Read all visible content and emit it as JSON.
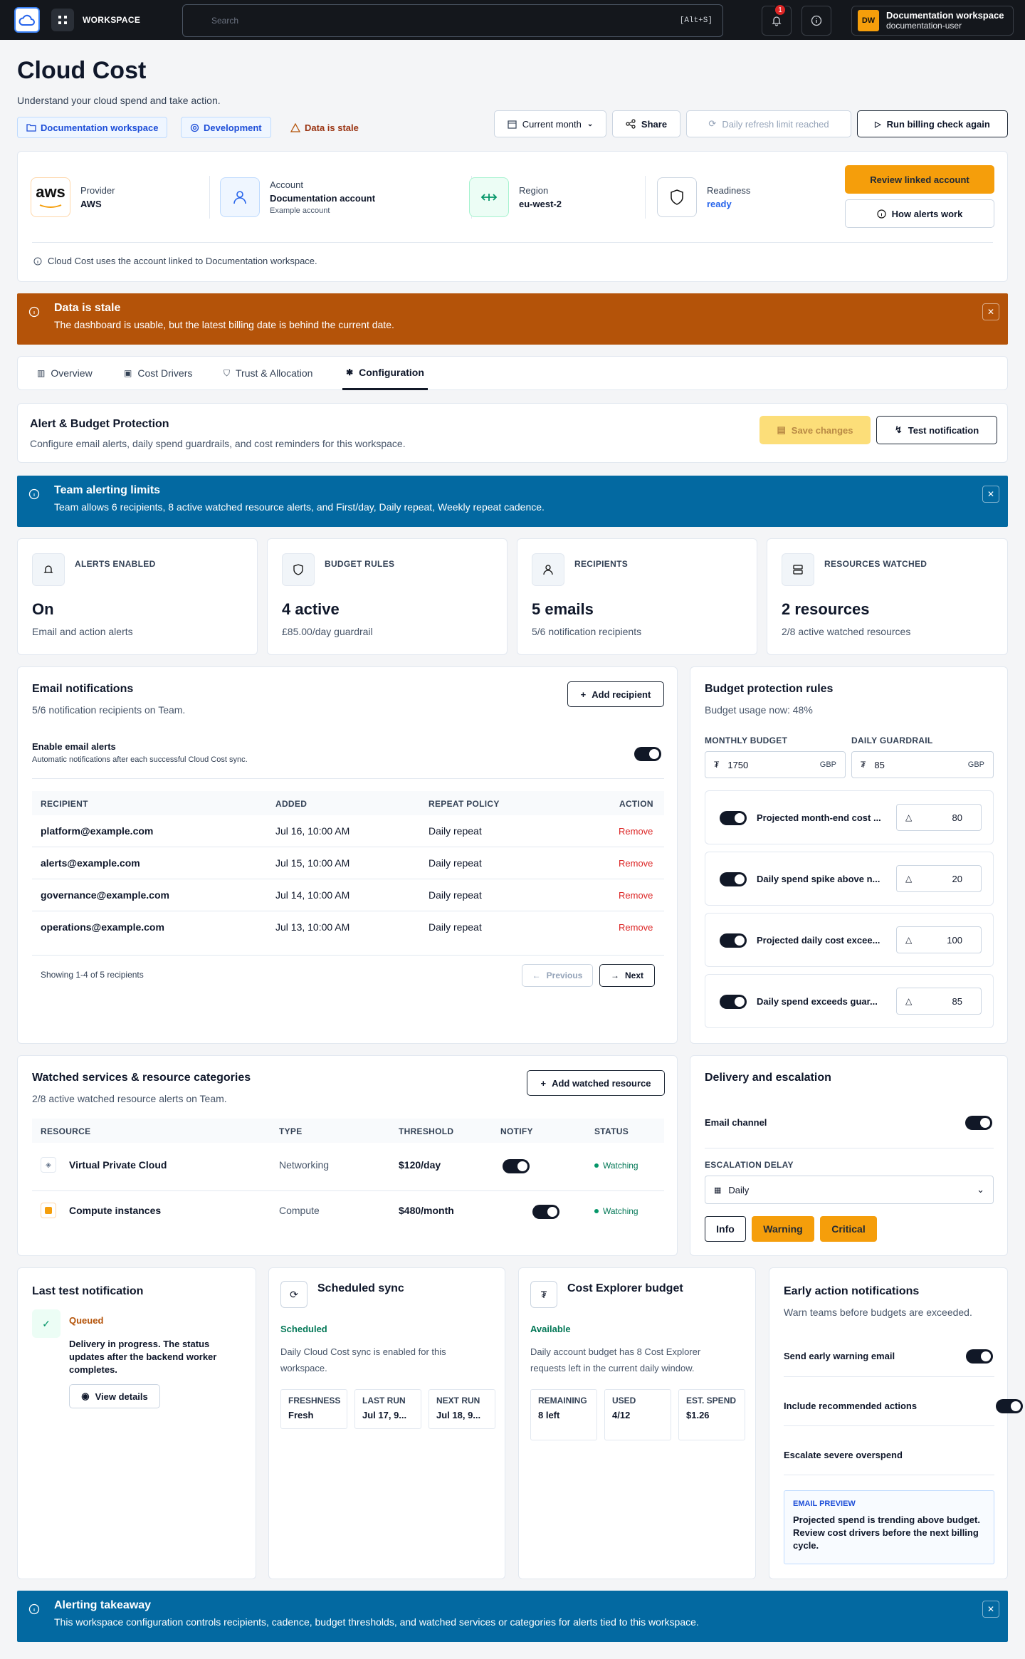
{
  "topbar": {
    "workspace_label": "WORKSPACE",
    "search_placeholder": "Search",
    "search_shortcut": "[Alt+S]",
    "notif_count": "1",
    "avatar_initials": "DW",
    "user_org": "Documentation workspace",
    "user_name": "documentation-user"
  },
  "header": {
    "title": "Cloud Cost",
    "subtitle": "Understand your cloud spend and take action.",
    "pill_workspace": "Documentation workspace",
    "pill_env": "Development",
    "stale_label": "Data is stale",
    "period": "Current month",
    "share": "Share",
    "refresh_limit": "Daily refresh limit reached",
    "run_billing": "Run billing check again"
  },
  "account": {
    "provider_label": "Provider",
    "provider_value": "AWS",
    "provider_logo": "aws",
    "account_label": "Account",
    "account_value": "Documentation account",
    "account_sub": "Example account",
    "region_label": "Region",
    "region_value": "eu-west-2",
    "readiness_label": "Readiness",
    "readiness_value": "ready",
    "review_button": "Review linked account",
    "alerts_button": "How alerts work",
    "note": "Cloud Cost uses the account linked to Documentation workspace."
  },
  "stale_banner": {
    "title": "Data is stale",
    "body": "The dashboard is usable, but the latest billing date is behind the current date."
  },
  "tabs": [
    "Overview",
    "Cost Drivers",
    "Trust & Allocation",
    "Configuration"
  ],
  "alert_section": {
    "title": "Alert & Budget Protection",
    "subtitle": "Configure email alerts, daily spend guardrails, and cost reminders for this workspace.",
    "save": "Save changes",
    "test": "Test notification"
  },
  "team_banner": {
    "title": "Team alerting limits",
    "body": "Team allows 6 recipients, 8 active watched resource alerts, and First/day, Daily repeat, Weekly repeat cadence."
  },
  "stats": [
    {
      "label": "ALERTS ENABLED",
      "value": "On",
      "sub": "Email and action alerts"
    },
    {
      "label": "BUDGET RULES",
      "value": "4 active",
      "sub": "£85.00/day guardrail"
    },
    {
      "label": "RECIPIENTS",
      "value": "5 emails",
      "sub": "5/6 notification recipients"
    },
    {
      "label": "RESOURCES WATCHED",
      "value": "2 resources",
      "sub": "2/8 active watched resources"
    }
  ],
  "email": {
    "title": "Email notifications",
    "subtitle": "5/6 notification recipients on Team.",
    "add": "Add recipient",
    "enable_label": "Enable email alerts",
    "enable_sub": "Automatic notifications after each successful Cloud Cost sync.",
    "enabled": true,
    "columns": [
      "RECIPIENT",
      "ADDED",
      "REPEAT POLICY",
      "ACTION"
    ],
    "rows": [
      {
        "email": "platform@example.com",
        "added": "Jul 16, 10:00 AM",
        "policy": "Daily repeat",
        "action": "Remove"
      },
      {
        "email": "alerts@example.com",
        "added": "Jul 15, 10:00 AM",
        "policy": "Daily repeat",
        "action": "Remove"
      },
      {
        "email": "governance@example.com",
        "added": "Jul 14, 10:00 AM",
        "policy": "Daily repeat",
        "action": "Remove"
      },
      {
        "email": "operations@example.com",
        "added": "Jul 13, 10:00 AM",
        "policy": "Daily repeat",
        "action": "Remove"
      }
    ],
    "showing": "Showing 1-4 of 5 recipients",
    "prev": "Previous",
    "next": "Next"
  },
  "budget": {
    "title": "Budget protection rules",
    "usage": "Budget usage now: 48%",
    "monthly_label": "MONTHLY BUDGET",
    "monthly_value": "1750",
    "monthly_cur": "GBP",
    "daily_label": "DAILY GUARDRAIL",
    "daily_value": "85",
    "daily_cur": "GBP",
    "rules": [
      {
        "label": "Projected month-end cost ...",
        "value": "80"
      },
      {
        "label": "Daily spend spike above n...",
        "value": "20"
      },
      {
        "label": "Projected daily cost excee...",
        "value": "100"
      },
      {
        "label": "Daily spend exceeds guar...",
        "value": "85"
      }
    ]
  },
  "watched": {
    "title": "Watched services & resource categories",
    "subtitle": "2/8 active watched resource alerts on Team.",
    "add": "Add watched resource",
    "columns": [
      "RESOURCE",
      "TYPE",
      "THRESHOLD",
      "NOTIFY",
      "STATUS"
    ],
    "rows": [
      {
        "name": "Virtual Private Cloud",
        "type": "Networking",
        "threshold": "$120/day",
        "status": "Watching"
      },
      {
        "name": "Compute instances",
        "type": "Compute",
        "threshold": "$480/month",
        "status": "Watching"
      }
    ]
  },
  "delivery": {
    "title": "Delivery and escalation",
    "channel": "Email channel",
    "delay_label": "ESCALATION DELAY",
    "delay_value": "Daily",
    "levels": [
      "Info",
      "Warning",
      "Critical"
    ]
  },
  "last_test": {
    "title": "Last test notification",
    "status": "Queued",
    "body": "Delivery in progress. The status updates after the backend worker completes.",
    "view": "View details"
  },
  "sync": {
    "title": "Scheduled sync",
    "status": "Scheduled",
    "body": "Daily Cloud Cost sync is enabled for this workspace.",
    "fresh_l": "FRESHNESS",
    "fresh_v": "Fresh",
    "last_l": "LAST RUN",
    "last_v": "Jul 17, 9...",
    "next_l": "NEXT RUN",
    "next_v": "Jul 18, 9..."
  },
  "explorer": {
    "title": "Cost Explorer budget",
    "status": "Available",
    "body": "Daily account budget has 8 Cost Explorer requests left in the current daily window.",
    "rem_l": "REMAINING",
    "rem_v": "8 left",
    "used_l": "USED",
    "used_v": "4/12",
    "est_l": "EST. SPEND",
    "est_v": "$1.26"
  },
  "early": {
    "title": "Early action notifications",
    "subtitle": "Warn teams before budgets are exceeded.",
    "items": [
      "Send early warning email",
      "Include recommended actions",
      "Escalate severe overspend"
    ],
    "preview_label": "EMAIL PREVIEW",
    "preview_body": "Projected spend is trending above budget. Review cost drivers before the next billing cycle."
  },
  "takeaway": {
    "title": "Alerting takeaway",
    "body": "This workspace configuration controls recipients, cadence, budget thresholds, and watched services or categories for alerts tied to this workspace."
  }
}
